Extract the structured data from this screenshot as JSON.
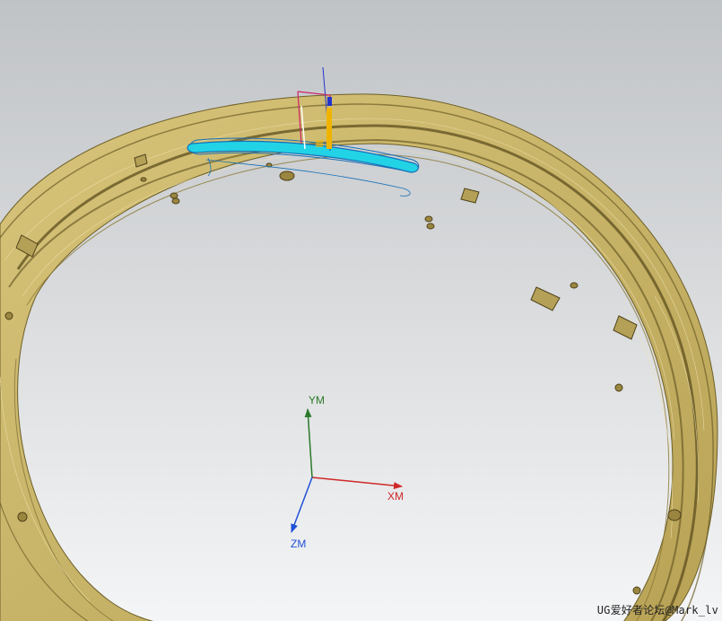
{
  "viewport": {
    "background_top": "#c0c3c6",
    "background_bottom": "#f4f5f6",
    "part_color": "#c8b468",
    "part_shadow": "#7a6a2e",
    "part_highlight": "#e4d496",
    "selection_color": "#22d3e6",
    "selection_edge": "#1670b8"
  },
  "triad": {
    "x_label": "XM",
    "y_label": "YM",
    "z_label": "ZM",
    "x_color": "#d02828",
    "y_color": "#2a7a2a",
    "z_color": "#2050d8"
  },
  "handle": {
    "axis_color": "#2233cc",
    "frame_color": "#cc2266",
    "handle_color": "#f0b400"
  },
  "watermark": {
    "text": "UG爱好者论坛@Mark_lv"
  }
}
